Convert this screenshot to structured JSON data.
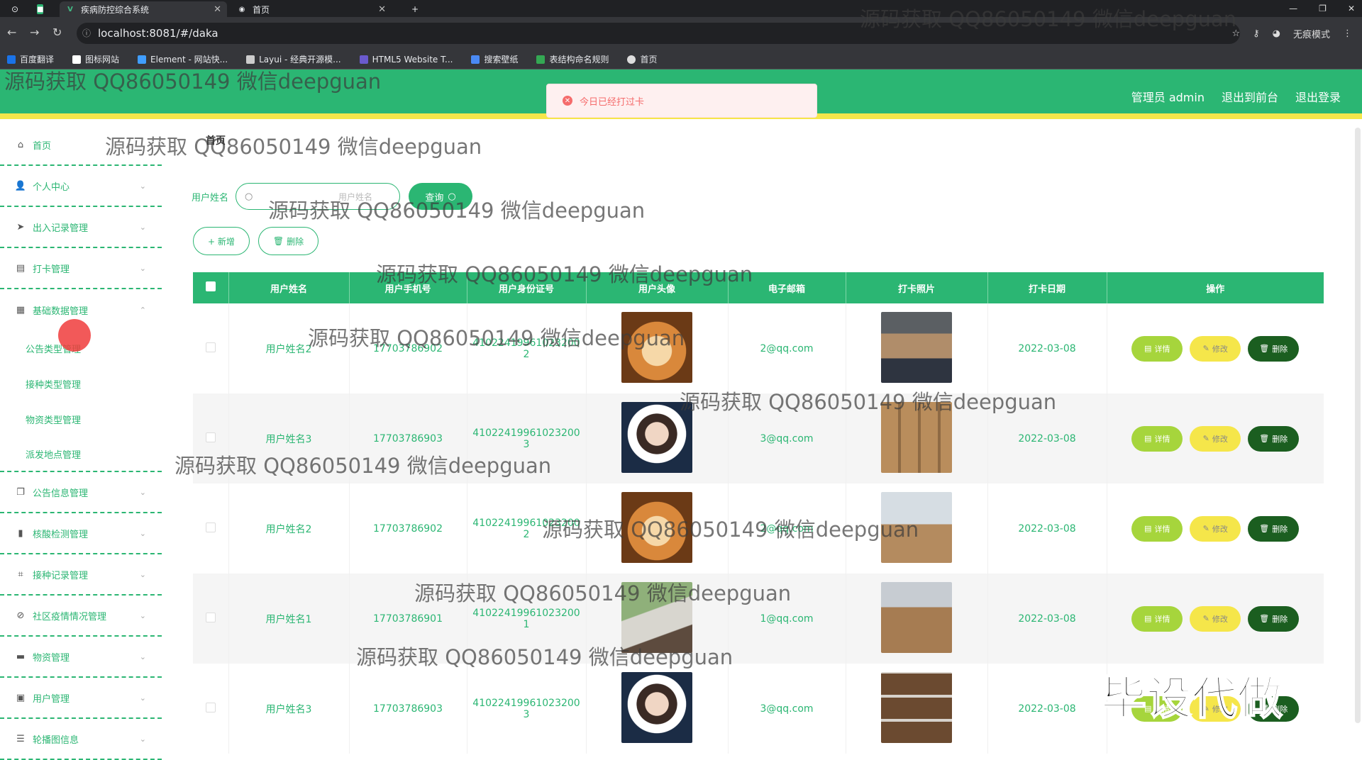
{
  "browser": {
    "tabs": [
      {
        "title": "疾病防控综合系统",
        "active": true
      },
      {
        "title": "首页",
        "active": false
      }
    ],
    "new_tab": "+",
    "url": "localhost:8081/#/daka",
    "incognito": "无痕模式",
    "bookmarks": [
      "百度翻译",
      "图标网站",
      "Element - 网站快...",
      "Layui - 经典开源模...",
      "HTML5 Website T...",
      "搜索壁纸",
      "表结构命名规则",
      "首页"
    ]
  },
  "header": {
    "admin": "管理员 admin",
    "back_front": "退出到前台",
    "logout": "退出登录"
  },
  "toast": {
    "message": "今日已经打过卡"
  },
  "sidebar": {
    "items": [
      {
        "label": "首页",
        "icon": "home-icon"
      },
      {
        "label": "个人中心",
        "icon": "user-icon"
      },
      {
        "label": "出入记录管理",
        "icon": "send-icon"
      },
      {
        "label": "打卡管理",
        "icon": "printer-icon"
      },
      {
        "label": "基础数据管理",
        "icon": "clipboard-icon"
      }
    ],
    "subitems": [
      "公告类型管理",
      "接种类型管理",
      "物资类型管理",
      "派发地点管理"
    ],
    "items_after": [
      {
        "label": "公告信息管理",
        "icon": "copy-icon"
      },
      {
        "label": "核酸检测管理",
        "icon": "chart-icon"
      },
      {
        "label": "接种记录管理",
        "icon": "crop-icon"
      },
      {
        "label": "社区疫情情况管理",
        "icon": "ban-icon"
      },
      {
        "label": "物资管理",
        "icon": "box-icon"
      },
      {
        "label": "用户管理",
        "icon": "doc-icon"
      },
      {
        "label": "轮播图信息",
        "icon": "sliders-icon"
      }
    ]
  },
  "main": {
    "breadcrumb": "首页",
    "search_label": "用户姓名",
    "search_placeholder": "用户姓名",
    "query_button": "查询",
    "add_button": "+ 新增",
    "delete_button": "删除",
    "columns": [
      "用户姓名",
      "用户手机号",
      "用户身份证号",
      "用户头像",
      "电子邮箱",
      "打卡照片",
      "打卡日期",
      "操作"
    ],
    "rows": [
      {
        "name": "用户姓名2",
        "phone": "17703786902",
        "id_a": "41022419961023200",
        "id_b": "2",
        "avatar": "dog",
        "email": "2@qq.com",
        "photo": "ph1",
        "date": "2022-03-08"
      },
      {
        "name": "用户姓名3",
        "phone": "17703786903",
        "id_a": "41022419961023200",
        "id_b": "3",
        "avatar": "boy",
        "email": "3@qq.com",
        "photo": "ph2",
        "date": "2022-03-08"
      },
      {
        "name": "用户姓名2",
        "phone": "17703786902",
        "id_a": "41022419961023200",
        "id_b": "2",
        "avatar": "dog",
        "email": "2@qq.com",
        "photo": "ph3",
        "date": "2022-03-08"
      },
      {
        "name": "用户姓名1",
        "phone": "17703786901",
        "id_a": "41022419961023200",
        "id_b": "1",
        "avatar": "girl",
        "email": "1@qq.com",
        "photo": "ph4",
        "date": "2022-03-08"
      },
      {
        "name": "用户姓名3",
        "phone": "17703786903",
        "id_a": "41022419961023200",
        "id_b": "3",
        "avatar": "boy",
        "email": "3@qq.com",
        "photo": "ph5",
        "date": "2022-03-08"
      }
    ],
    "row_actions": {
      "detail": "详情",
      "edit": "修改",
      "delete": "删除"
    }
  },
  "watermark": "源码获取 QQ86050149 微信deepguan",
  "watermark_big": "毕设代做"
}
